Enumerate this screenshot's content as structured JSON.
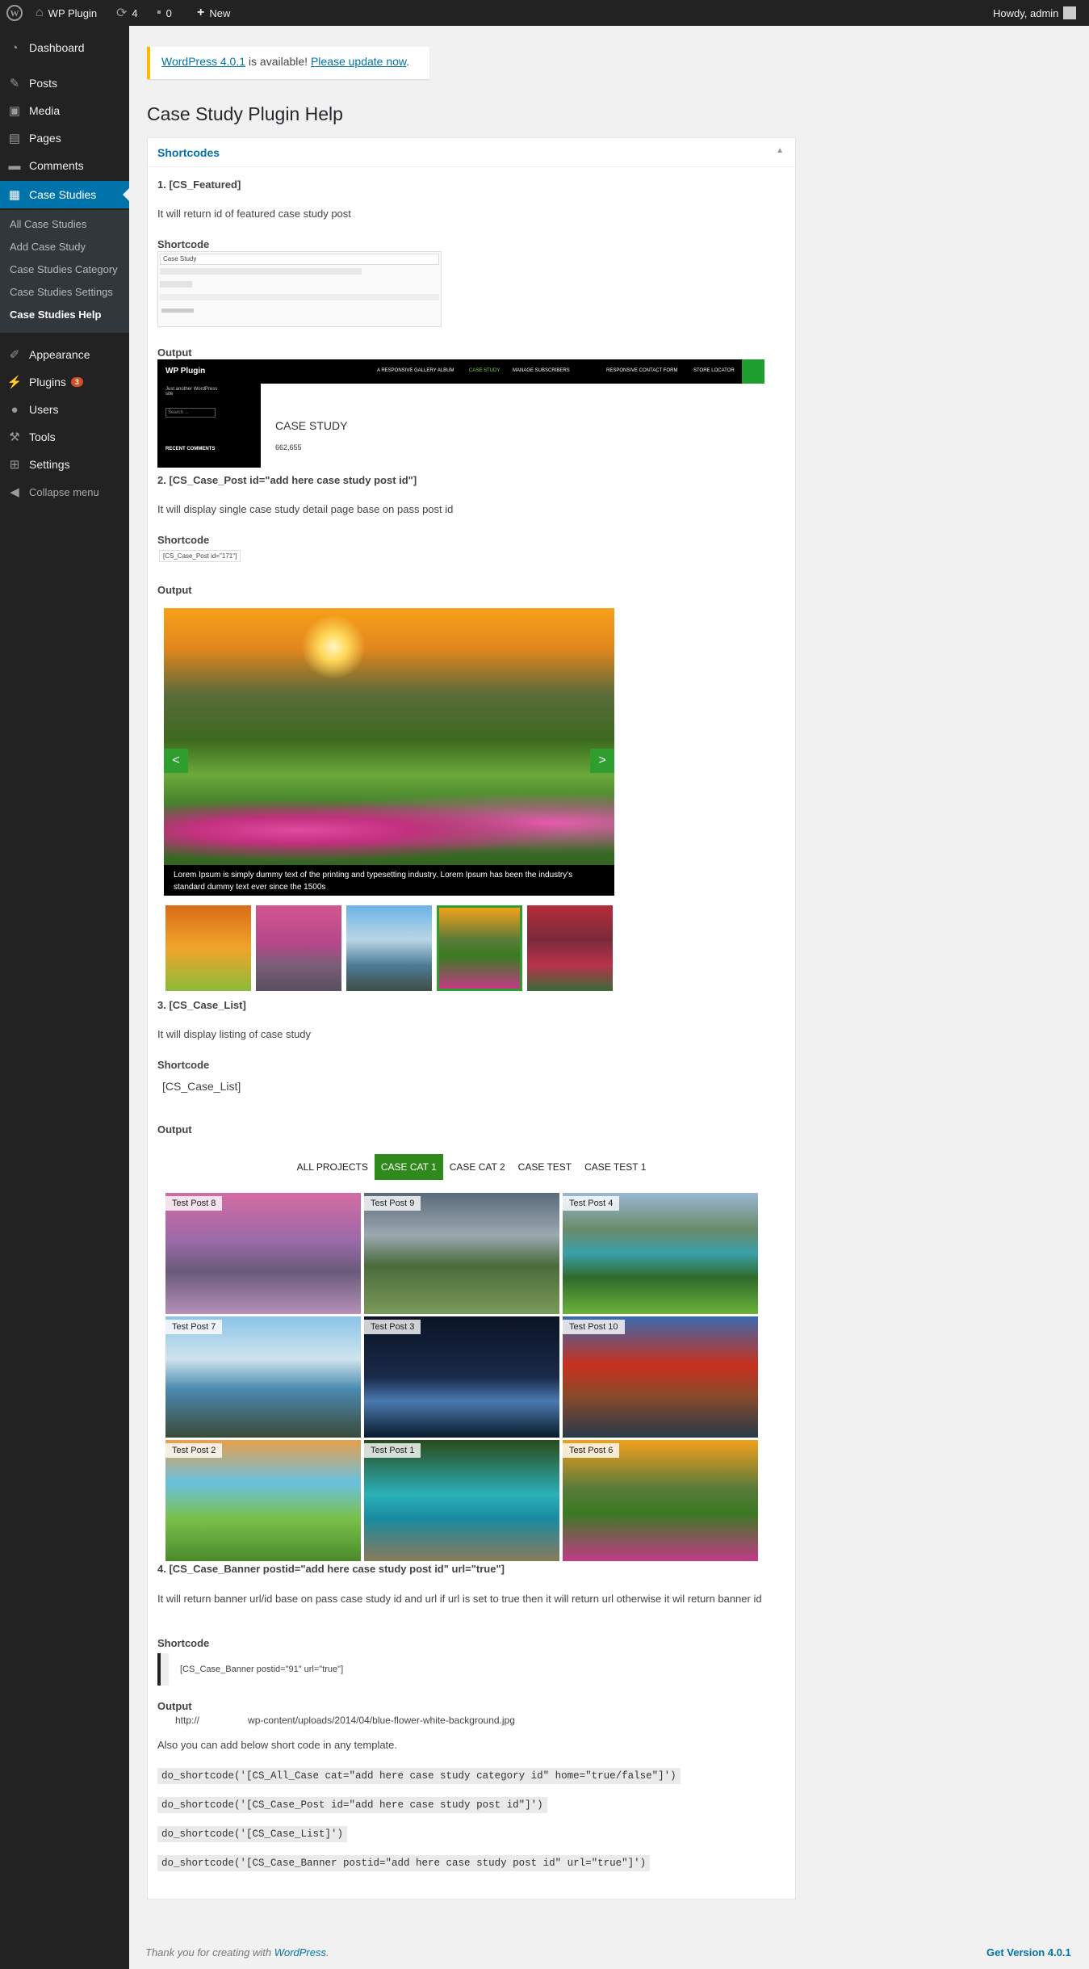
{
  "adminbar": {
    "site_name": "WP Plugin",
    "updates_count": "4",
    "comments_count": "0",
    "new_label": "New",
    "howdy": "Howdy, admin"
  },
  "sidebar": {
    "items": [
      {
        "label": "Dashboard"
      },
      {
        "label": "Posts"
      },
      {
        "label": "Media"
      },
      {
        "label": "Pages"
      },
      {
        "label": "Comments"
      },
      {
        "label": "Case Studies"
      },
      {
        "label": "Appearance"
      },
      {
        "label": "Plugins",
        "badge": "3"
      },
      {
        "label": "Users"
      },
      {
        "label": "Tools"
      },
      {
        "label": "Settings"
      },
      {
        "label": "Collapse menu"
      }
    ],
    "submenu": [
      "All Case Studies",
      "Add Case Study",
      "Case Studies Category",
      "Case Studies Settings",
      "Case Studies Help"
    ]
  },
  "notice": {
    "link1": "WordPress 4.0.1",
    "text": " is available! ",
    "link2": "Please update now",
    "end": "."
  },
  "page_title": "Case Study Plugin Help",
  "box_title": "Shortcodes",
  "s1": {
    "heading": "1. [CS_Featured]",
    "desc": "It will return id of featured case study post",
    "shortcode_label": "Shortcode",
    "output_label": "Output",
    "editor_title": "Case Study",
    "demo_site": "WP Plugin",
    "demo_nav": [
      "A RESPONSIVE GALLERY ALBUM",
      "CASE STUDY",
      "MANAGE SUBSCRIBERS",
      "RESPONSIVE CONTACT FORM",
      "STORE LOCATOR"
    ],
    "demo_tagline": "Just another WordPress site",
    "demo_search": "Search ...",
    "demo_recent": "RECENT COMMENTS",
    "demo_heading": "CASE STUDY",
    "demo_id": "662,655"
  },
  "s2": {
    "heading": "2. [CS_Case_Post id=\"add here case study post id\"]",
    "desc": "It will display single case study detail page base on pass post id",
    "shortcode_label": "Shortcode",
    "code": "[CS_Case_Post id=\"171\"]",
    "output_label": "Output",
    "caption": "Lorem Ipsum is simply dummy text of the printing and typesetting industry. Lorem Ipsum has been the industry's standard dummy text ever since the 1500s",
    "prev": "<",
    "next": ">"
  },
  "s3": {
    "heading": "3. [CS_Case_List]",
    "desc": "It will display listing of case study",
    "shortcode_label": "Shortcode",
    "code": "[CS_Case_List]",
    "output_label": "Output",
    "tabs": [
      "ALL PROJECTS",
      "CASE CAT 1",
      "CASE CAT 2",
      "CASE TEST",
      "CASE TEST 1"
    ],
    "posts": [
      "Test Post 8",
      "Test Post 9",
      "Test Post 4",
      "Test Post 7",
      "Test Post 3",
      "Test Post 10",
      "Test Post 2",
      "Test Post 1",
      "Test Post 6"
    ]
  },
  "s4": {
    "heading": "4. [CS_Case_Banner postid=\"add here case study post id\" url=\"true\"]",
    "desc": "It will return banner url/id base on pass case study id and url if url is set to true then it will return url otherwise it wil return banner id",
    "shortcode_label": "Shortcode",
    "code": "[CS_Case_Banner postid=\"91\" url=\"true\"]",
    "output_label": "Output",
    "output": "http://                  wp-content/uploads/2014/04/blue-flower-white-background.jpg"
  },
  "also": "Also you can add below short code in any template.",
  "snippets": [
    "do_shortcode('[CS_All_Case cat=\"add here case study category id\" home=\"true/false\"]')",
    "do_shortcode('[CS_Case_Post id=\"add here case study post id\"]')",
    "do_shortcode('[CS_Case_List]')",
    "do_shortcode('[CS_Case_Banner postid=\"add here case study post id\" url=\"true\"]')"
  ],
  "footer": {
    "thanks": "Thank you for creating with ",
    "wp": "WordPress",
    "dot": ".",
    "version": "Get Version 4.0.1"
  }
}
